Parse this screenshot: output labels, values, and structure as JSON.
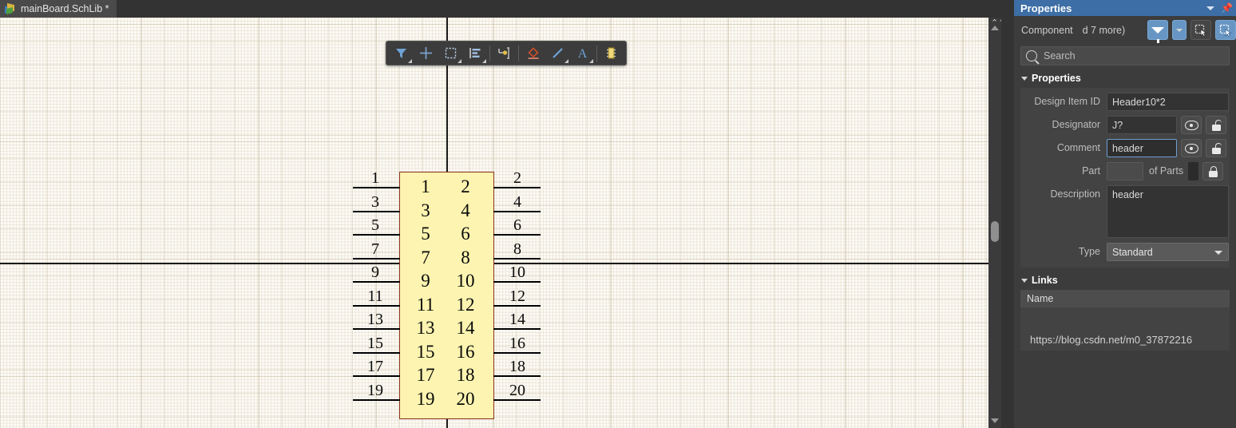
{
  "window": {
    "tab_title": "mainBoard.SchLib *",
    "tab_icon": "schlib-file-icon"
  },
  "canvas_toolbar": {
    "buttons": [
      {
        "name": "filter-tool",
        "icon": "funnel-icon",
        "has_dropdown": true
      },
      {
        "name": "crosshair-tool",
        "icon": "crosshair-icon",
        "has_dropdown": false
      },
      {
        "name": "selection-tool",
        "icon": "marquee-select-icon",
        "has_dropdown": true
      },
      {
        "name": "align-tool",
        "icon": "align-left-icon",
        "has_dropdown": true
      },
      {
        "name": "place-pin-tool",
        "icon": "pin-icon",
        "has_dropdown": false
      },
      {
        "name": "place-polygon-tool",
        "icon": "polygon-icon",
        "has_dropdown": false
      },
      {
        "name": "place-line-tool",
        "icon": "line-icon",
        "has_dropdown": true
      },
      {
        "name": "place-text-tool",
        "icon": "text-a-icon",
        "has_dropdown": true
      },
      {
        "name": "place-component-tool",
        "icon": "ic-chip-icon",
        "has_dropdown": false
      }
    ]
  },
  "schematic": {
    "component_label": "Header10*2",
    "pins_left": [
      "1",
      "3",
      "5",
      "7",
      "9",
      "11",
      "13",
      "15",
      "17",
      "19"
    ],
    "pins_right": [
      "2",
      "4",
      "6",
      "8",
      "10",
      "12",
      "14",
      "16",
      "18",
      "20"
    ],
    "body_fill": "#fcf4b0",
    "body_border": "#8a2f16",
    "pin_color": "#000000"
  },
  "panel": {
    "title": "Properties",
    "collapse_icon": "chevron-down-icon",
    "pin_icon": "pushpin-icon",
    "object_type": "Component",
    "object_more": "d 7 more)",
    "header_buttons": [
      {
        "name": "filter-toggle-button",
        "icon": "funnel-icon",
        "active": true
      },
      {
        "name": "filter-dropdown-button",
        "icon": "chevron-down-icon",
        "active": true
      },
      {
        "name": "select-similar-button",
        "icon": "cursor-select-icon",
        "active": false
      },
      {
        "name": "select-all-button",
        "icon": "cursor-select-all-icon",
        "active": true
      }
    ],
    "search": {
      "placeholder": "Search",
      "icon": "search-icon"
    },
    "properties_section": {
      "title": "Properties",
      "fields": {
        "design_item_id_label": "Design Item ID",
        "design_item_id_value": "Header10*2",
        "designator_label": "Designator",
        "designator_value": "J?",
        "comment_label": "Comment",
        "comment_value": "header",
        "part_label": "Part",
        "part_value": "",
        "of_parts_label": "of Parts",
        "description_label": "Description",
        "description_value": "header",
        "type_label": "Type",
        "type_value": "Standard"
      },
      "row_icons": {
        "visibility": "eye-icon",
        "lock_open": "lock-open-icon",
        "lock_closed": "lock-closed-icon"
      }
    },
    "links_section": {
      "title": "Links",
      "column_header": "Name",
      "rows": [
        "https://blog.csdn.net/m0_37872216"
      ]
    }
  },
  "colors": {
    "panel_title_bg": "#3d6ea5",
    "panel_bg": "#3c3c3c",
    "canvas_bg": "#fdfbf5",
    "accent_blue": "#6896d0"
  }
}
